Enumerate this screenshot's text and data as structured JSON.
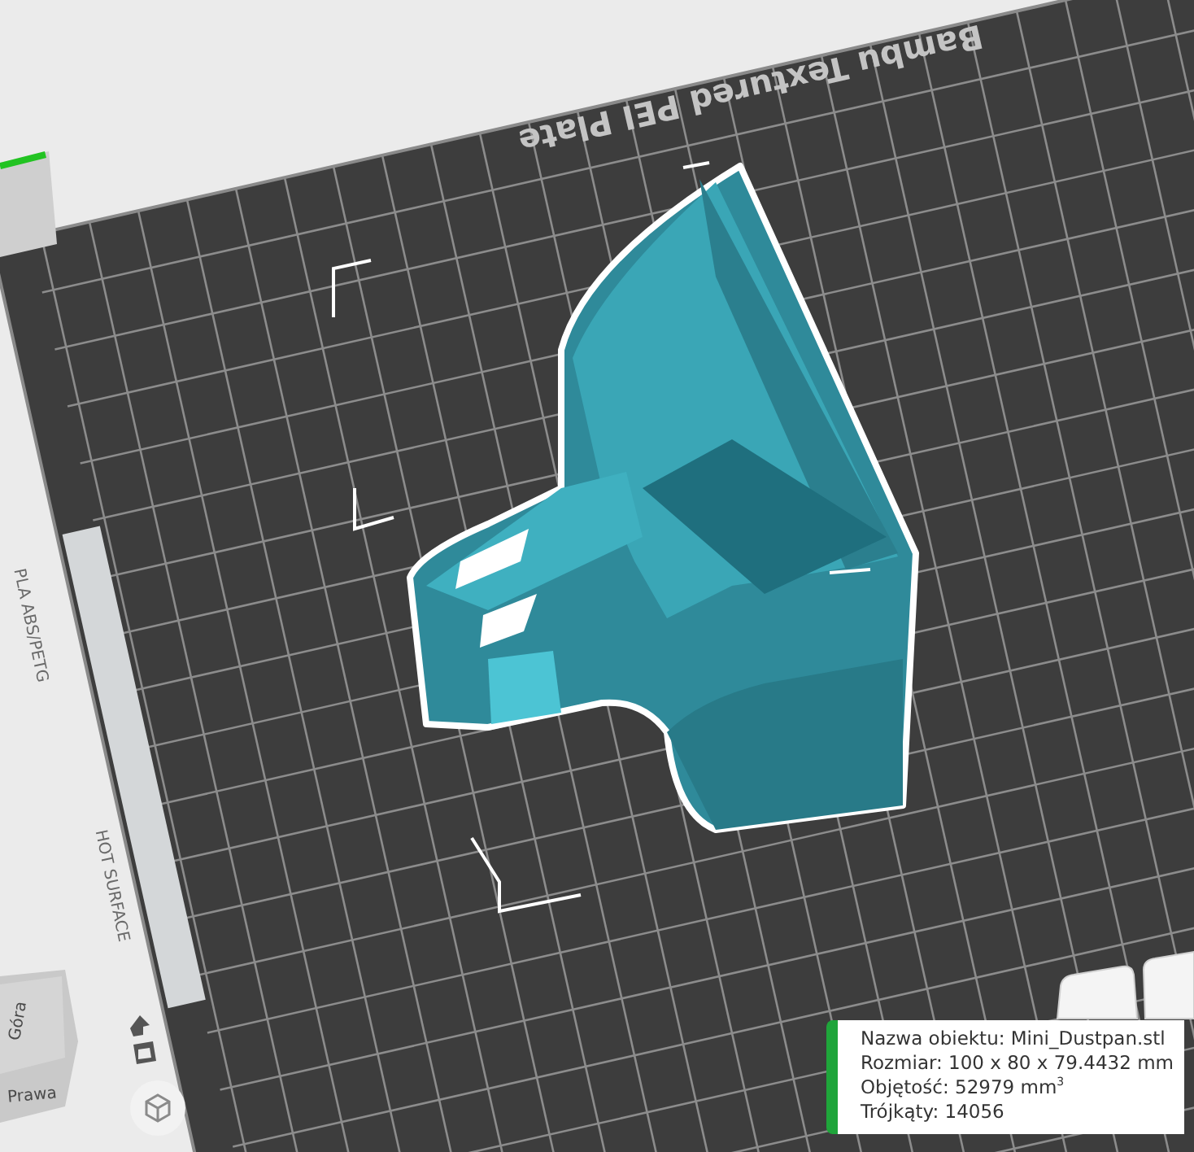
{
  "plate": {
    "label": "Bambu Textured PEI Plate",
    "strip": [
      {
        "text": "PLA ABS/PETG"
      },
      {
        "text": "HOT SURFACE"
      }
    ]
  },
  "view_cube": {
    "faces": [
      "Góra",
      "Prawa"
    ]
  },
  "object_info": {
    "lines": [
      "Nazwa obiektu: Mini_Dustpan.stl",
      "Rozmiar: 100 x 80 x 79.4432 mm",
      "Objętość: 52979 mm$^{3}$",
      "Trójkąty: 14056"
    ]
  }
}
